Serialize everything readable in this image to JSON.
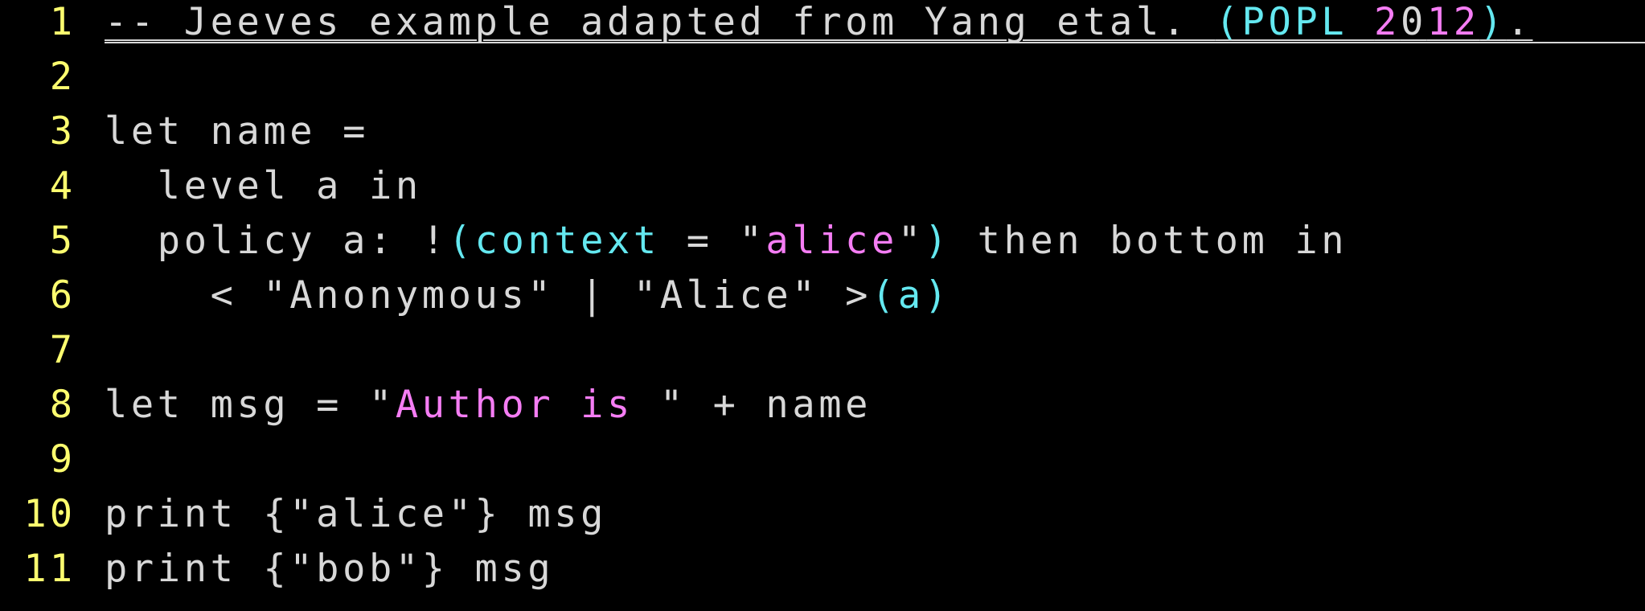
{
  "colors": {
    "background": "#000000",
    "line_number": "#fdfd6f",
    "text": "#d8d8d8",
    "cyan": "#64e8f0",
    "magenta": "#f57df4"
  },
  "lines": [
    {
      "number": "1",
      "tokens": [
        {
          "text": "-- Jeeves example adapted from Yang etal. ",
          "color": "text"
        },
        {
          "text": "(POPL ",
          "color": "cyan"
        },
        {
          "text": "2",
          "color": "magenta"
        },
        {
          "text": "0",
          "color": "text"
        },
        {
          "text": "12",
          "color": "magenta"
        },
        {
          "text": ")",
          "color": "cyan"
        },
        {
          "text": ".",
          "color": "text"
        }
      ]
    },
    {
      "number": "2",
      "tokens": []
    },
    {
      "number": "3",
      "tokens": [
        {
          "text": "let name =",
          "color": "text"
        }
      ]
    },
    {
      "number": "4",
      "tokens": [
        {
          "text": "  level a in",
          "color": "text"
        }
      ]
    },
    {
      "number": "5",
      "tokens": [
        {
          "text": "  policy a: !",
          "color": "text"
        },
        {
          "text": "(context",
          "color": "cyan"
        },
        {
          "text": " = \"",
          "color": "text"
        },
        {
          "text": "alice",
          "color": "magenta"
        },
        {
          "text": "\"",
          "color": "text"
        },
        {
          "text": ")",
          "color": "cyan"
        },
        {
          "text": " then bottom in",
          "color": "text"
        }
      ]
    },
    {
      "number": "6",
      "tokens": [
        {
          "text": "    < \"Anonymous\" | \"Alice\" >",
          "color": "text"
        },
        {
          "text": "(a)",
          "color": "cyan"
        }
      ]
    },
    {
      "number": "7",
      "tokens": []
    },
    {
      "number": "8",
      "tokens": [
        {
          "text": "let msg = \"",
          "color": "text"
        },
        {
          "text": "Author is ",
          "color": "magenta"
        },
        {
          "text": "\" + name",
          "color": "text"
        }
      ]
    },
    {
      "number": "9",
      "tokens": []
    },
    {
      "number": "10",
      "tokens": [
        {
          "text": "print {\"alice\"} msg",
          "color": "text"
        }
      ]
    },
    {
      "number": "11",
      "tokens": [
        {
          "text": "print {\"bob\"} msg",
          "color": "text"
        }
      ]
    }
  ]
}
